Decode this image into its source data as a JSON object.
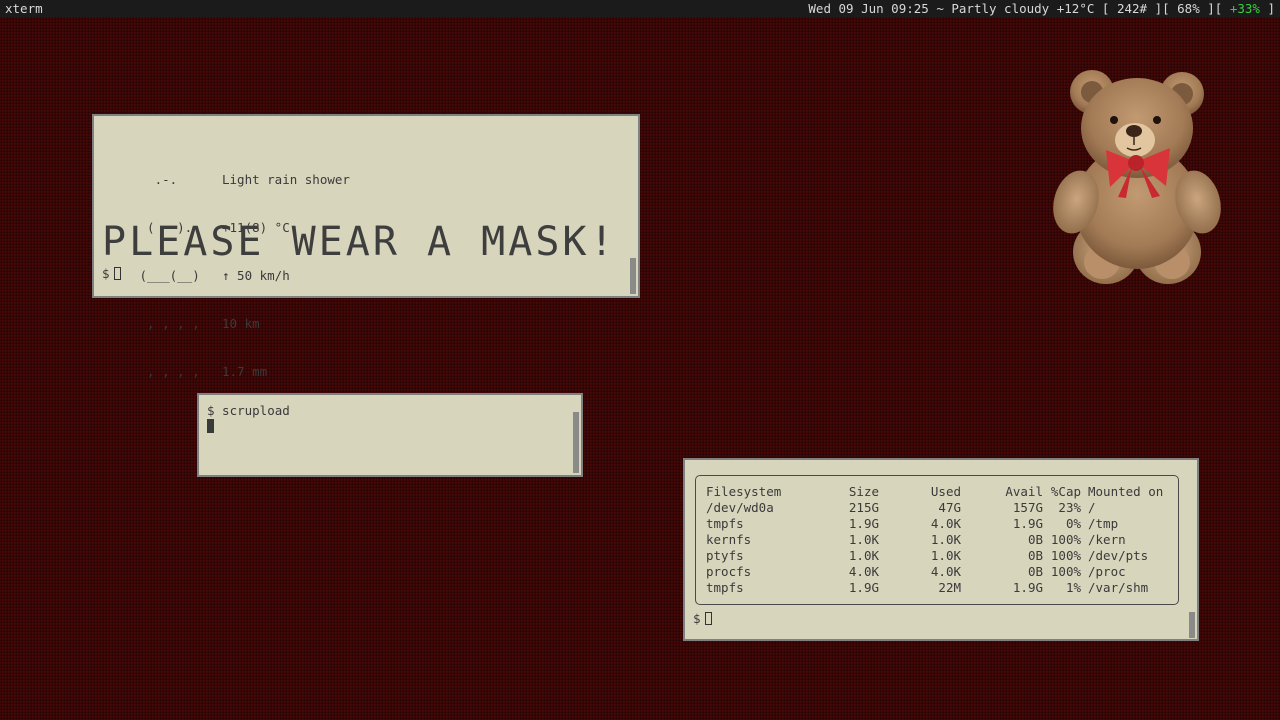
{
  "topbar": {
    "title": "xterm",
    "status_main": "Wed 09 Jun 09:25 ~ Partly cloudy +12°C [ 242# ][ 68% ][ ",
    "status_green": "+33%",
    "status_end": " ]"
  },
  "weather_terminal": {
    "ascii_art": [
      "   .-.   ",
      "  (   ). ",
      " (___(__)",
      "  ‚ ‚ ‚ ‚ ",
      "  ‚ ‚ ‚ ‚ "
    ],
    "info": [
      "Light rain shower",
      "+11(8) °C",
      "↑ 50 km/h",
      "10 km",
      "1.7 mm"
    ],
    "banner": "PLEASE WEAR A MASK!",
    "prompt": "$"
  },
  "scrupload_terminal": {
    "command_line": "$ scrupload"
  },
  "df_terminal": {
    "headers": [
      "Filesystem",
      "Size",
      "Used",
      "Avail",
      "%Cap",
      "Mounted on"
    ],
    "rows": [
      [
        "/dev/wd0a",
        "215G",
        "47G",
        "157G",
        "23%",
        "/"
      ],
      [
        "tmpfs",
        "1.9G",
        "4.0K",
        "1.9G",
        "0%",
        "/tmp"
      ],
      [
        "kernfs",
        "1.0K",
        "1.0K",
        "0B",
        "100%",
        "/kern"
      ],
      [
        "ptyfs",
        "1.0K",
        "1.0K",
        "0B",
        "100%",
        "/dev/pts"
      ],
      [
        "procfs",
        "4.0K",
        "4.0K",
        "0B",
        "100%",
        "/proc"
      ],
      [
        "tmpfs",
        "1.9G",
        "22M",
        "1.9G",
        "1%",
        "/var/shm"
      ]
    ],
    "prompt": "$"
  },
  "wallpaper": {
    "image": "teddy-bear",
    "background_color": "#3a0606",
    "bow_color": "#d8343a",
    "bear_color": "#a27a55"
  },
  "colors": {
    "terminal_bg": "#d8d5bd",
    "terminal_fg": "#3a3a3a",
    "accent_green": "#38d23b"
  }
}
